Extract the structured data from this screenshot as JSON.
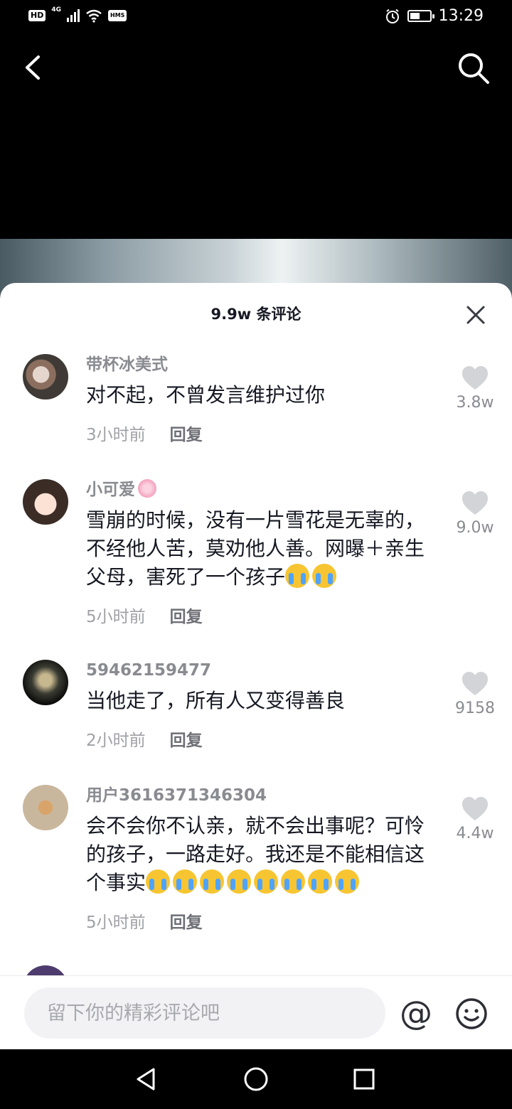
{
  "status_bar": {
    "hd_label": "HD",
    "network_label": "4G",
    "hms_label": "HMS",
    "time": "13:29",
    "battery_level": 0.45
  },
  "sheet": {
    "title": "9.9w 条评论"
  },
  "comments": [
    {
      "user": "带杯冰美式",
      "text": "对不起，不曾发言维护过你",
      "time": "3小时前",
      "reply_label": "回复",
      "likes": "3.8w",
      "emoji_count": 0
    },
    {
      "user": "小可爱",
      "text": "雪崩的时候，没有一片雪花是无辜的，不经他人苦，莫劝他人善。网曝＋亲生父母，害死了一个孩子",
      "time": "5小时前",
      "reply_label": "回复",
      "likes": "9.0w",
      "emoji_count": 2
    },
    {
      "user": "59462159477",
      "text": "当他走了，所有人又变得善良",
      "time": "2小时前",
      "reply_label": "回复",
      "likes": "9158",
      "emoji_count": 0
    },
    {
      "user": "用户3616371346304",
      "text": "会不会你不认亲，就不会出事呢？可怜的孩子，一路走好。我还是不能相信这个事实",
      "time": "5小时前",
      "reply_label": "回复",
      "likes": "4.4w",
      "emoji_count": 8
    }
  ],
  "input_bar": {
    "placeholder": "留下你的精彩评论吧",
    "at_label": "@"
  },
  "icons": {
    "back": "back-arrow-icon",
    "search": "search-icon",
    "close": "close-icon",
    "like": "heart-icon",
    "emoji": "smiley-icon",
    "nav_back": "triangle-back-icon",
    "nav_home": "circle-home-icon",
    "nav_recent": "square-recent-icon"
  },
  "colors": {
    "like_gray": "#d3d4d8",
    "text_primary": "#161823",
    "text_secondary": "#8a8b91"
  }
}
